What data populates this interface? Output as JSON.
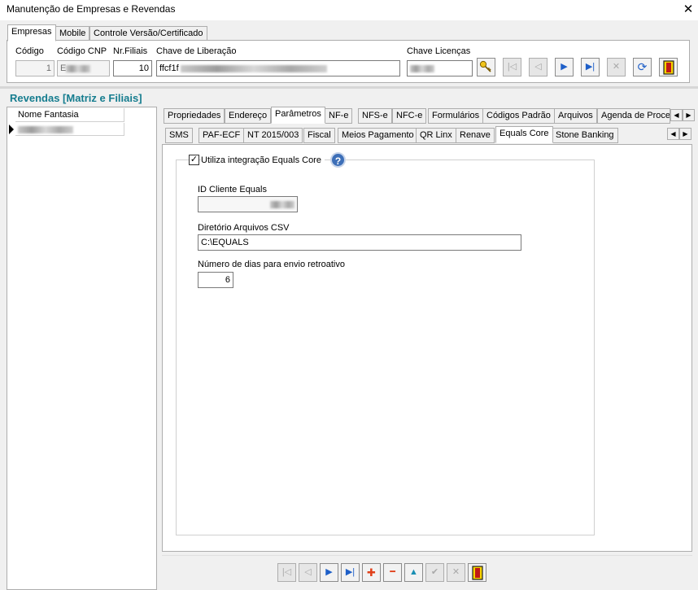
{
  "window": {
    "title": "Manutenção de Empresas e Revendas",
    "close_glyph": "✕"
  },
  "top_tabs": [
    "Empresas",
    "Mobile",
    "Controle Versão/Certificado"
  ],
  "company": {
    "codigo_label": "Código",
    "codigo_value": "1",
    "cnpj_label": "Código CNP",
    "cnpj_value": "E",
    "filiais_label": "Nr.Filiais",
    "filiais_value": "10",
    "chave_lib_label": "Chave de Liberação",
    "chave_lib_value": "ffcf1f",
    "chave_lic_label": "Chave Licenças"
  },
  "nav_glyphs": {
    "first": "|◁",
    "prev": "◁",
    "next": "▶",
    "last": "▶|",
    "cancel": "✕",
    "refresh": "⟳",
    "add": "✚",
    "remove": "━",
    "up": "▲",
    "confirm": "✔"
  },
  "section_title": "Revendas [Matriz e Filiais]",
  "grid": {
    "column": "Nome Fantasia"
  },
  "tabs_row1": [
    "Propriedades",
    "Endereço",
    "Parâmetros",
    "NF-e",
    "NFS-e",
    "NFC-e",
    "Formulários",
    "Códigos Padrão",
    "Arquivos",
    "Agenda de Proces"
  ],
  "tabs_row2": [
    "SMS",
    "PAF-ECF",
    "NT 2015/003",
    "Fiscal",
    "Meios Pagamento",
    "QR Linx",
    "Renave",
    "Equals Core",
    "Stone Banking"
  ],
  "scroll_glyphs": {
    "left": "◀",
    "right": "▶"
  },
  "equals": {
    "checkbox_label": "Utiliza integração Equals Core",
    "checked_glyph": "✓",
    "help_glyph": "?",
    "id_label": "ID Cliente Equals",
    "dir_label": "Diretório Arquivos CSV",
    "dir_value": "C:\\EQUALS",
    "days_label": "Número de dias para envio retroativo",
    "days_value": "6"
  },
  "colors": {
    "accent": "#167d8f",
    "nav_blue": "#1e5fc8",
    "add_red": "#e0401a"
  }
}
